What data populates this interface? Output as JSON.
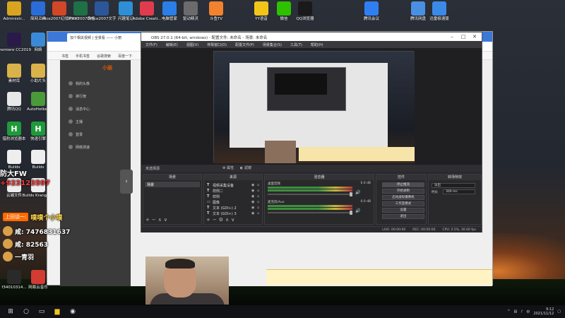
{
  "desktop": {
    "icons_top": [
      {
        "label": "Administr...",
        "icon": "admin-icon",
        "color": "#d9a520"
      },
      {
        "label": "简网工具",
        "icon": "tool-icon",
        "color": "#2a6dd9"
      },
      {
        "label": "Office2007幻灯片PPT",
        "icon": "ppt-icon",
        "color": "#d24726"
      },
      {
        "label": "Office2007表格",
        "icon": "excel-icon",
        "color": "#1e7145"
      },
      {
        "label": "Office2007文字",
        "icon": "word-icon",
        "color": "#2b579a"
      },
      {
        "label": "闪趣笔记",
        "icon": "notes-icon",
        "color": "#2f8fd6"
      },
      {
        "label": "Adobe Creati...",
        "icon": "adobe-icon",
        "color": "#e03c4d"
      },
      {
        "label": "电脑管家",
        "icon": "shield-icon",
        "color": "#2a7ee6"
      },
      {
        "label": "驱动精灵",
        "icon": "driver-icon",
        "color": "#6b6b6b"
      },
      {
        "label": "斗鱼TV",
        "icon": "douyu-icon",
        "color": "#f2822d"
      },
      {
        "label": "YY语音",
        "icon": "yy-icon",
        "color": "#f2c618"
      },
      {
        "label": "微信",
        "icon": "wechat-icon",
        "color": "#2dc100"
      },
      {
        "label": "QQ浏览器",
        "icon": "qq-icon",
        "color": "#1a1a1a"
      },
      {
        "label": "腾讯会议",
        "icon": "meeting-icon",
        "color": "#2f7ff3"
      },
      {
        "label": "腾讯网盘",
        "icon": "cloud-icon",
        "color": "#4a90e2"
      },
      {
        "label": "迅雷极速版",
        "icon": "thunder-icon",
        "color": "#3c8ae8"
      }
    ],
    "icons_left": [
      {
        "label": "Premiere CC2019",
        "icon": "premiere-icon",
        "color": "#2a1a4a"
      },
      {
        "label": "网络",
        "icon": "network-icon",
        "color": "#3a8ad8"
      },
      {
        "label": "素材库",
        "icon": "folder-icon",
        "color": "#d9b24a"
      },
      {
        "label": "小助片头",
        "icon": "folder-icon",
        "color": "#d9b24a"
      },
      {
        "label": "腾讯QQ",
        "icon": "file-icon",
        "color": "#e8e8e8"
      },
      {
        "label": "AutoHotkey",
        "icon": "ahk-icon",
        "color": "#4a9a3a"
      },
      {
        "label": "猎豹浏览器本",
        "icon": "h-icon",
        "color": "#1f9a3a"
      },
      {
        "label": "快速引擎",
        "icon": "h-icon",
        "color": "#1f9a3a"
      },
      {
        "label": "Builds",
        "icon": "doc-icon",
        "color": "#eeeeee"
      },
      {
        "label": "Builds",
        "icon": "doc-icon",
        "color": "#eeeeee"
      },
      {
        "label": "云端文件",
        "icon": "doc-icon",
        "color": "#eeeeee"
      },
      {
        "label": "Builds Krangle...",
        "icon": "doc-icon",
        "color": "#eeeeee"
      },
      {
        "label": "f34010314...",
        "icon": "video-icon",
        "color": "#2a2a2a"
      },
      {
        "label": "网易云音乐",
        "icon": "music-icon",
        "color": "#d43c33"
      }
    ]
  },
  "browser": {
    "tab_title": "加个相关视频 | 全景看 —— 小丽",
    "bookmarks": [
      "书签",
      "手机书签",
      "谷歌搜索",
      "百度一下"
    ],
    "logo": "小丽",
    "sidebar_items": [
      "我的头像",
      "排行榜",
      "消息中心",
      "主播",
      "登录",
      "网络测速"
    ]
  },
  "obs": {
    "title": "OBS 27.0.1 (64-bit, windows) - 配置文件: 未命名 - 场景: 未命名",
    "menu": [
      "文件(F)",
      "编辑(E)",
      "视图(V)",
      "停靠窗口(D)",
      "配置文件(P)",
      "场景集合(S)",
      "工具(T)",
      "帮助(H)"
    ],
    "preview_bar_label": "未选择源",
    "preview_gear": "属性",
    "preview_filter": "滤镜",
    "docks": {
      "scenes": "场景",
      "sources": "来源",
      "mixer": "混音器",
      "transitions": "转场特效",
      "controls": "控件"
    },
    "scene_item": "场景",
    "sources": [
      {
        "type": "T",
        "name": "视频采集设备"
      },
      {
        "type": "T",
        "name": "样例二"
      },
      {
        "type": "T",
        "name": "样例"
      },
      {
        "type": "▭",
        "name": "图像"
      },
      {
        "type": "T",
        "name": "文本 (GDI+) 2"
      },
      {
        "type": "T",
        "name": "文本 (GDI+) 3"
      }
    ],
    "mixer": [
      {
        "name": "桌面音频",
        "db": "0.0 dB"
      },
      {
        "name": "麦克风/Aux",
        "db": "0.0 dB"
      }
    ],
    "controls": [
      "停止推流",
      "开始录制",
      "启动虚拟摄像机",
      "工作室模式",
      "设置",
      "退出"
    ],
    "transition_value": "淡出",
    "transition_duration_label": "时长",
    "transition_duration": "300 ms",
    "status": [
      "LIVE: 00:00:00",
      "REC: 00:00:00",
      "CPU: 2.5%, 30.00 fps"
    ]
  },
  "overlay": {
    "name": "防大FW",
    "qq": "+923123597",
    "ticker_tag": "上回谈一:",
    "ticker_1": "噗噗个小噗",
    "ticker_2": "咸: 7476831637",
    "ticker_3": "咸: 82563",
    "ticker_4": "一青羽"
  },
  "taskbar": {
    "time": "9:12",
    "date": "2021/11/12",
    "lang": "中"
  }
}
